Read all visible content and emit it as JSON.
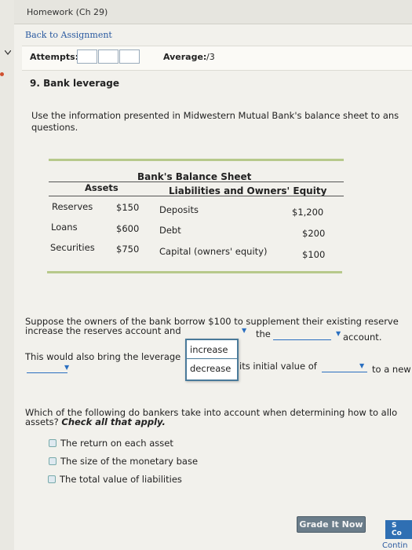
{
  "header": {
    "title": "Homework (Ch 29)"
  },
  "nav": {
    "back_label": "Back to Assignment"
  },
  "attempts": {
    "label": "Attempts:",
    "average_label": "Average:",
    "average_value": "/3"
  },
  "question": {
    "title": "9. Bank leverage",
    "intro_line1": "Use the information presented in Midwestern Mutual Bank's balance sheet to ans",
    "intro_line2": "questions."
  },
  "balance_sheet": {
    "title": "Bank's Balance Sheet",
    "assets_header": "Assets",
    "liabilities_header": "Liabilities and Owners' Equity",
    "rows": [
      {
        "asset": "Reserves",
        "asset_value": "$150",
        "liability": "Deposits",
        "liability_value": "$1,200"
      },
      {
        "asset": "Loans",
        "asset_value": "$600",
        "liability": "Debt",
        "liability_value": "$200"
      },
      {
        "asset": "Securities",
        "asset_value": "$750",
        "liability": "Capital (owners' equity)",
        "liability_value": "$100"
      }
    ]
  },
  "part2": {
    "line1": "Suppose the owners of the bank borrow $100 to supplement their existing reserve",
    "line2": "increase the reserves account and",
    "the_word": "the",
    "account_word": "account."
  },
  "dropdown_popup": {
    "options": [
      "increase",
      "decrease"
    ]
  },
  "part3": {
    "line": "This would also bring the leverage",
    "rest": "its initial value of",
    "tail": "to a new"
  },
  "part4": {
    "line1": "Which of the following do bankers take into account when determining how to allo",
    "line2_prefix": "assets? ",
    "line2_emph": "Check all that apply.",
    "options": [
      "The return on each asset",
      "The size of the monetary base",
      "The total value of liabilities"
    ]
  },
  "footer": {
    "grade_label": "Grade It Now",
    "save_label_line1": "S",
    "save_label_line2": "Co",
    "continue_label": "Contin"
  }
}
